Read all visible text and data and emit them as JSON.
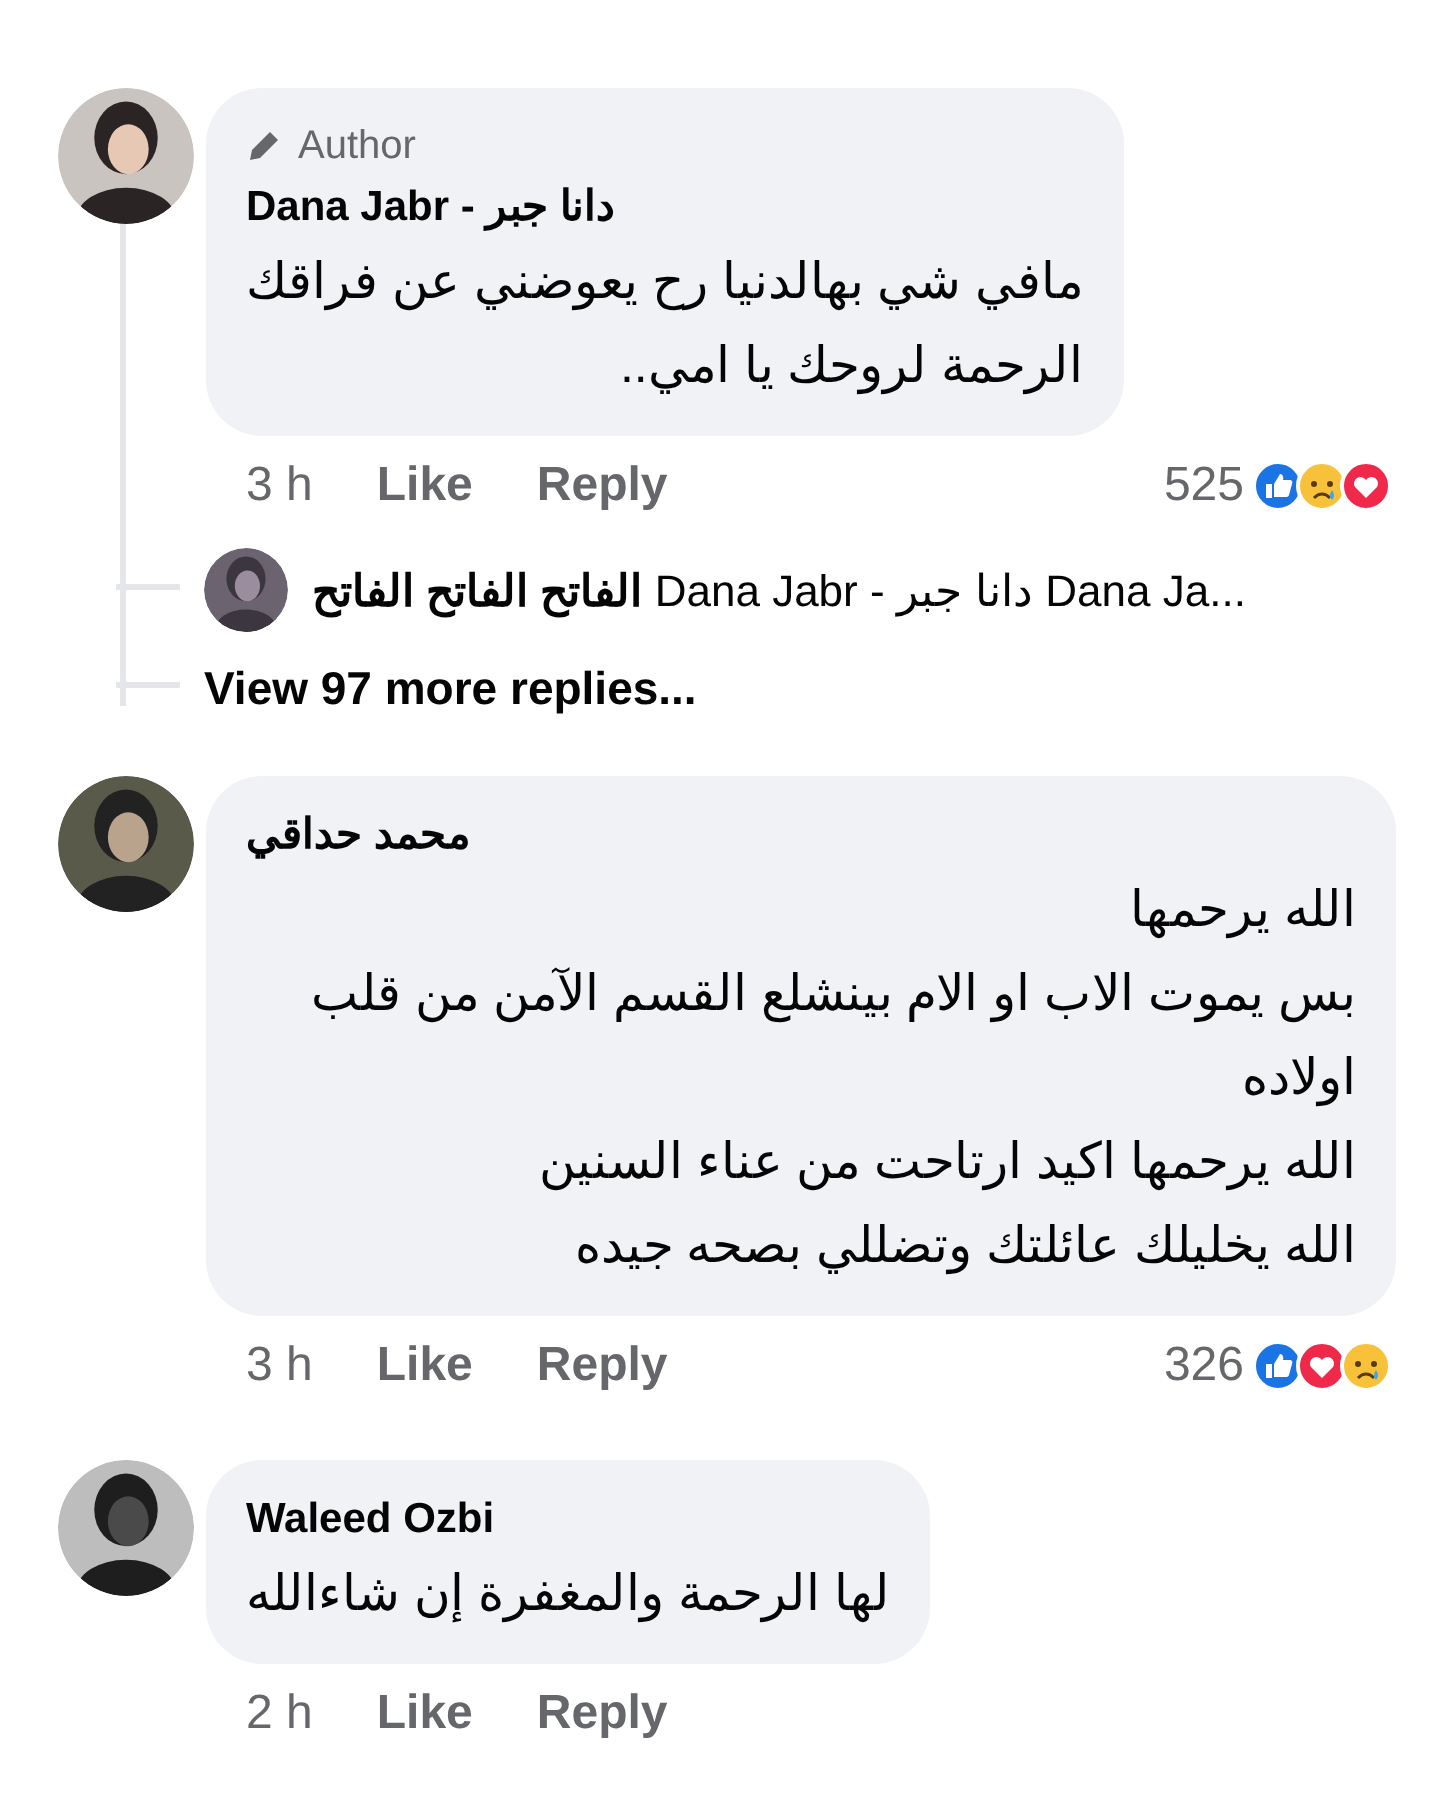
{
  "comments": [
    {
      "author_badge": "Author",
      "name": "Dana Jabr - دانا جبر",
      "lines": [
        "مافي شي بهالدنيا رح يعوضني عن فراقك",
        "الرحمة لروحك يا امي.."
      ],
      "time": "3 h",
      "like": "Like",
      "reply": "Reply",
      "reaction_count": "525",
      "reactions": [
        {
          "kind": "like"
        },
        {
          "kind": "sad"
        },
        {
          "kind": "love"
        }
      ],
      "replies": [
        {
          "name": "الفاتح الفاتح الفاتح",
          "text": "Dana Jabr - دانا جبر Dana Ja..."
        }
      ],
      "more_replies": "View 97 more replies..."
    },
    {
      "name": "محمد حداقي",
      "lines": [
        "الله يرحمها",
        "بس يموت الاب او الام بينشلع القسم الآمن من قلب اولاده",
        "الله يرحمها اكيد ارتاحت من عناء السنين",
        "الله يخليلك عائلتك وتضللي بصحه جيده"
      ],
      "time": "3 h",
      "like": "Like",
      "reply": "Reply",
      "reaction_count": "326",
      "reactions": [
        {
          "kind": "like"
        },
        {
          "kind": "love"
        },
        {
          "kind": "sad"
        }
      ]
    },
    {
      "name": "Waleed Ozbi",
      "lines": [
        "لها الرحمة والمغفرة إن شاءالله"
      ],
      "time": "2 h",
      "like": "Like",
      "reply": "Reply"
    }
  ]
}
